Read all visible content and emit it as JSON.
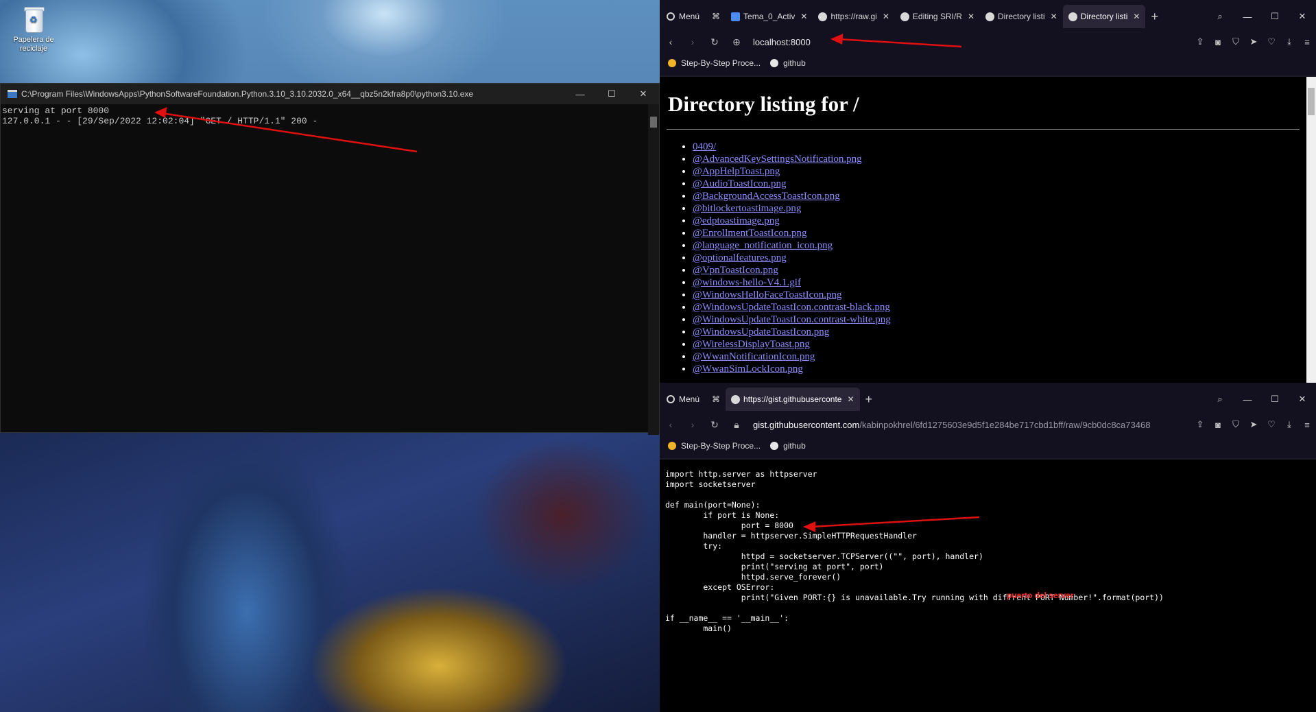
{
  "desktop": {
    "recycle_bin_label": "Papelera de reciclaje"
  },
  "terminal": {
    "title": "C:\\Program Files\\WindowsApps\\PythonSoftwareFoundation.Python.3.10_3.10.2032.0_x64__qbz5n2kfra8p0\\python3.10.exe",
    "lines": [
      "serving at port 8000",
      "127.0.0.1 - - [29/Sep/2022 12:02:04] \"GET / HTTP/1.1\" 200 -"
    ]
  },
  "browser_top": {
    "menu_label": "Menú",
    "tabs": [
      {
        "label": "Tema_0_Activ"
      },
      {
        "label": "https://raw.gi"
      },
      {
        "label": "Editing SRI/R"
      },
      {
        "label": "Directory listi"
      },
      {
        "label": "Directory listi"
      }
    ],
    "url": "localhost:8000",
    "bookmarks": [
      {
        "label": "Step-By-Step Proce..."
      },
      {
        "label": "github"
      }
    ],
    "page": {
      "heading": "Directory listing for /",
      "files": [
        "0409/",
        "@AdvancedKeySettingsNotification.png",
        "@AppHelpToast.png",
        "@AudioToastIcon.png",
        "@BackgroundAccessToastIcon.png",
        "@bitlockertoastimage.png",
        "@edptoastimage.png",
        "@EnrollmentToastIcon.png",
        "@language_notification_icon.png",
        "@optionalfeatures.png",
        "@VpnToastIcon.png",
        "@windows-hello-V4.1.gif",
        "@WindowsHelloFaceToastIcon.png",
        "@WindowsUpdateToastIcon.contrast-black.png",
        "@WindowsUpdateToastIcon.contrast-white.png",
        "@WindowsUpdateToastIcon.png",
        "@WirelessDisplayToast.png",
        "@WwanNotificationIcon.png",
        "@WwanSimLockIcon.png"
      ]
    }
  },
  "browser_bottom": {
    "menu_label": "Menú",
    "tabs": [
      {
        "label": "https://gist.githubuserconte"
      }
    ],
    "url_host": "gist.githubusercontent.com",
    "url_path": "/kabinpokhrel/6fd1275603e9d5f1e284be717cbd1bff/raw/9cb0dc8ca73468",
    "bookmarks": [
      {
        "label": "Step-By-Step Proce..."
      },
      {
        "label": "github"
      }
    ],
    "code": "import http.server as httpserver\nimport socketserver\n\ndef main(port=None):\n        if port is None:\n                port = 8000\n        handler = httpserver.SimpleHTTPRequestHandler\n        try:\n                httpd = socketserver.TCPServer((\"\", port), handler)\n                print(\"serving at port\", port)\n                httpd.serve_forever()\n        except OSError:\n                print(\"Given PORT:{} is unavailable.Try running with diffrent PORT Number!\".format(port))\n\nif __name__ == '__main__':\n        main()",
    "annotation": "puerto del server"
  },
  "colors": {
    "annotation": "#ff2a2a",
    "link": "#8c8cff",
    "tabbar": "#13101f"
  }
}
